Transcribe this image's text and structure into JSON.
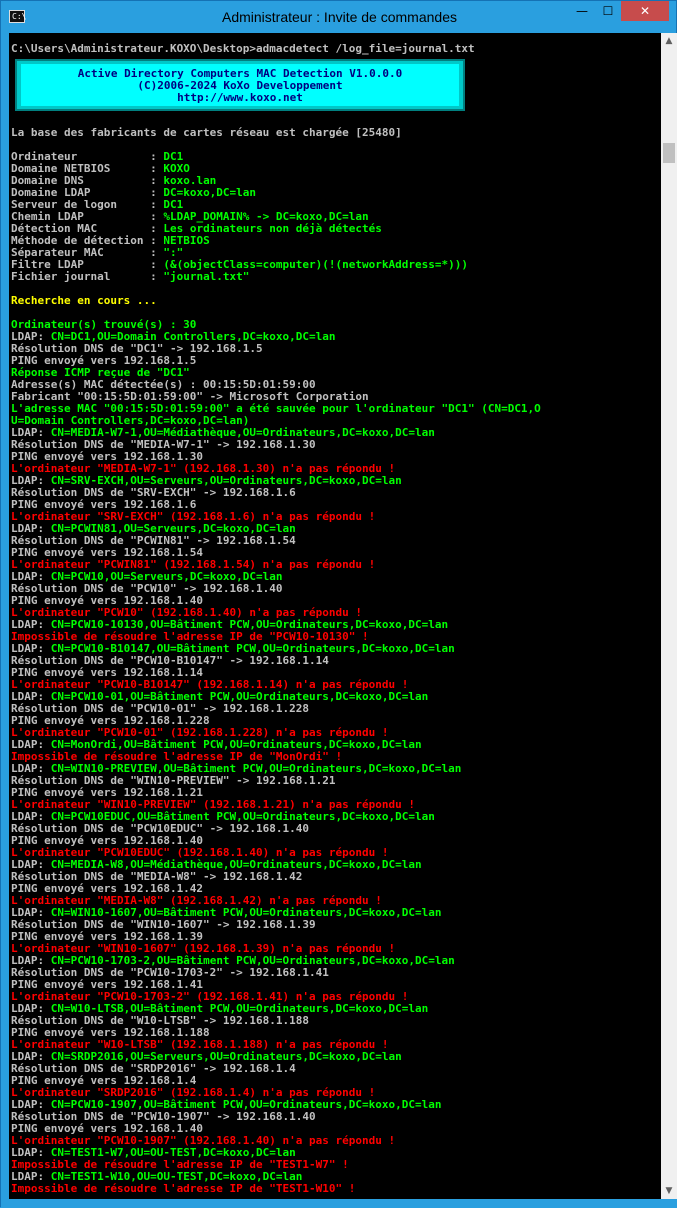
{
  "window": {
    "title": "Administrateur : Invite de commandes",
    "icon_glyph": "C:\\",
    "buttons": {
      "minimize": "—",
      "maximize": "☐",
      "close": "✕"
    }
  },
  "scrollbar": {
    "up": "▲",
    "down": "▼"
  },
  "console": {
    "banner": [
      "Active Directory Computers MAC Detection V1.0.0.0",
      "(C)2006-2024 KoXo Developpement",
      "http://www.koxo.net"
    ],
    "lines": [
      {
        "c": "white",
        "t": "C:\\Users\\Administrateur.KOXO\\Desktop>admacdetect /log_file=journal.txt"
      },
      {
        "c": "white",
        "t": ""
      },
      {
        "c": "white",
        "t": ""
      },
      {
        "c": "white",
        "t": ""
      },
      {
        "c": "white",
        "t": ""
      },
      {
        "c": "white",
        "t": ""
      },
      {
        "c": "white",
        "t": ""
      },
      {
        "c": "white",
        "t": "La base des fabricants de cartes réseau est chargée [25480]"
      },
      {
        "c": "white",
        "t": ""
      },
      {
        "c": "kv",
        "k": "Ordinateur           : ",
        "v": "DC1"
      },
      {
        "c": "kv",
        "k": "Domaine NETBIOS      : ",
        "v": "KOXO"
      },
      {
        "c": "kv",
        "k": "Domaine DNS          : ",
        "v": "koxo.lan"
      },
      {
        "c": "kv",
        "k": "Domaine LDAP         : ",
        "v": "DC=koxo,DC=lan"
      },
      {
        "c": "kv",
        "k": "Serveur de logon     : ",
        "v": "DC1"
      },
      {
        "c": "kv",
        "k": "Chemin LDAP          : ",
        "v": "%LDAP_DOMAIN% -> DC=koxo,DC=lan"
      },
      {
        "c": "kv",
        "k": "Détection MAC        : ",
        "v": "Les ordinateurs non déjà détectés"
      },
      {
        "c": "kv",
        "k": "Méthode de détection : ",
        "v": "NETBIOS"
      },
      {
        "c": "kv",
        "k": "Séparateur MAC       : ",
        "v": "\":\""
      },
      {
        "c": "kv",
        "k": "Filtre LDAP          : ",
        "v": "(&(objectClass=computer)(!(networkAddress=*)))"
      },
      {
        "c": "kv",
        "k": "Fichier journal      : ",
        "v": "\"journal.txt\""
      },
      {
        "c": "white",
        "t": ""
      },
      {
        "c": "yellow",
        "t": "Recherche en cours ..."
      },
      {
        "c": "white",
        "t": ""
      },
      {
        "c": "green",
        "t": "Ordinateur(s) trouvé(s) : 30"
      },
      {
        "c": "ldap",
        "v": "CN=DC1,OU=Domain Controllers,DC=koxo,DC=lan"
      },
      {
        "c": "white",
        "t": "Résolution DNS de \"DC1\" -> 192.168.1.5"
      },
      {
        "c": "white",
        "t": "PING envoyé vers 192.168.1.5"
      },
      {
        "c": "green",
        "t": "Réponse ICMP reçue de \"DC1\""
      },
      {
        "c": "white",
        "t": "Adresse(s) MAC détectée(s) : 00:15:5D:01:59:00"
      },
      {
        "c": "white",
        "t": "Fabricant \"00:15:5D:01:59:00\" -> Microsoft Corporation"
      },
      {
        "c": "green",
        "t": "L'adresse MAC \"00:15:5D:01:59:00\" a été sauvée pour l'ordinateur \"DC1\" (CN=DC1,O"
      },
      {
        "c": "green",
        "t": "U=Domain Controllers,DC=koxo,DC=lan)"
      },
      {
        "c": "ldap",
        "v": "CN=MEDIA-W7-1,OU=Médiathèque,OU=Ordinateurs,DC=koxo,DC=lan"
      },
      {
        "c": "white",
        "t": "Résolution DNS de \"MEDIA-W7-1\" -> 192.168.1.30"
      },
      {
        "c": "white",
        "t": "PING envoyé vers 192.168.1.30"
      },
      {
        "c": "red",
        "t": "L'ordinateur \"MEDIA-W7-1\" (192.168.1.30) n'a pas répondu !"
      },
      {
        "c": "ldap",
        "v": "CN=SRV-EXCH,OU=Serveurs,OU=Ordinateurs,DC=koxo,DC=lan"
      },
      {
        "c": "white",
        "t": "Résolution DNS de \"SRV-EXCH\" -> 192.168.1.6"
      },
      {
        "c": "white",
        "t": "PING envoyé vers 192.168.1.6"
      },
      {
        "c": "red",
        "t": "L'ordinateur \"SRV-EXCH\" (192.168.1.6) n'a pas répondu !"
      },
      {
        "c": "ldap",
        "v": "CN=PCWIN81,OU=Serveurs,DC=koxo,DC=lan"
      },
      {
        "c": "white",
        "t": "Résolution DNS de \"PCWIN81\" -> 192.168.1.54"
      },
      {
        "c": "white",
        "t": "PING envoyé vers 192.168.1.54"
      },
      {
        "c": "red",
        "t": "L'ordinateur \"PCWIN81\" (192.168.1.54) n'a pas répondu !"
      },
      {
        "c": "ldap",
        "v": "CN=PCW10,OU=Serveurs,DC=koxo,DC=lan"
      },
      {
        "c": "white",
        "t": "Résolution DNS de \"PCW10\" -> 192.168.1.40"
      },
      {
        "c": "white",
        "t": "PING envoyé vers 192.168.1.40"
      },
      {
        "c": "red",
        "t": "L'ordinateur \"PCW10\" (192.168.1.40) n'a pas répondu !"
      },
      {
        "c": "ldap",
        "v": "CN=PCW10-10130,OU=Bâtiment PCW,OU=Ordinateurs,DC=koxo,DC=lan"
      },
      {
        "c": "red",
        "t": "Impossible de résoudre l'adresse IP de \"PCW10-10130\" !"
      },
      {
        "c": "ldap",
        "v": "CN=PCW10-B10147,OU=Bâtiment PCW,OU=Ordinateurs,DC=koxo,DC=lan"
      },
      {
        "c": "white",
        "t": "Résolution DNS de \"PCW10-B10147\" -> 192.168.1.14"
      },
      {
        "c": "white",
        "t": "PING envoyé vers 192.168.1.14"
      },
      {
        "c": "red",
        "t": "L'ordinateur \"PCW10-B10147\" (192.168.1.14) n'a pas répondu !"
      },
      {
        "c": "ldap",
        "v": "CN=PCW10-01,OU=Bâtiment PCW,OU=Ordinateurs,DC=koxo,DC=lan"
      },
      {
        "c": "white",
        "t": "Résolution DNS de \"PCW10-01\" -> 192.168.1.228"
      },
      {
        "c": "white",
        "t": "PING envoyé vers 192.168.1.228"
      },
      {
        "c": "red",
        "t": "L'ordinateur \"PCW10-01\" (192.168.1.228) n'a pas répondu !"
      },
      {
        "c": "ldap",
        "v": "CN=MonOrdi,OU=Bâtiment PCW,OU=Ordinateurs,DC=koxo,DC=lan"
      },
      {
        "c": "red",
        "t": "Impossible de résoudre l'adresse IP de \"MonOrdi\" !"
      },
      {
        "c": "ldap",
        "v": "CN=WIN10-PREVIEW,OU=Bâtiment PCW,OU=Ordinateurs,DC=koxo,DC=lan"
      },
      {
        "c": "white",
        "t": "Résolution DNS de \"WIN10-PREVIEW\" -> 192.168.1.21"
      },
      {
        "c": "white",
        "t": "PING envoyé vers 192.168.1.21"
      },
      {
        "c": "red",
        "t": "L'ordinateur \"WIN10-PREVIEW\" (192.168.1.21) n'a pas répondu !"
      },
      {
        "c": "ldap",
        "v": "CN=PCW10EDUC,OU=Bâtiment PCW,OU=Ordinateurs,DC=koxo,DC=lan"
      },
      {
        "c": "white",
        "t": "Résolution DNS de \"PCW10EDUC\" -> 192.168.1.40"
      },
      {
        "c": "white",
        "t": "PING envoyé vers 192.168.1.40"
      },
      {
        "c": "red",
        "t": "L'ordinateur \"PCW10EDUC\" (192.168.1.40) n'a pas répondu !"
      },
      {
        "c": "ldap",
        "v": "CN=MEDIA-W8,OU=Médiathèque,OU=Ordinateurs,DC=koxo,DC=lan"
      },
      {
        "c": "white",
        "t": "Résolution DNS de \"MEDIA-W8\" -> 192.168.1.42"
      },
      {
        "c": "white",
        "t": "PING envoyé vers 192.168.1.42"
      },
      {
        "c": "red",
        "t": "L'ordinateur \"MEDIA-W8\" (192.168.1.42) n'a pas répondu !"
      },
      {
        "c": "ldap",
        "v": "CN=WIN10-1607,OU=Bâtiment PCW,OU=Ordinateurs,DC=koxo,DC=lan"
      },
      {
        "c": "white",
        "t": "Résolution DNS de \"WIN10-1607\" -> 192.168.1.39"
      },
      {
        "c": "white",
        "t": "PING envoyé vers 192.168.1.39"
      },
      {
        "c": "red",
        "t": "L'ordinateur \"WIN10-1607\" (192.168.1.39) n'a pas répondu !"
      },
      {
        "c": "ldap",
        "v": "CN=PCW10-1703-2,OU=Bâtiment PCW,OU=Ordinateurs,DC=koxo,DC=lan"
      },
      {
        "c": "white",
        "t": "Résolution DNS de \"PCW10-1703-2\" -> 192.168.1.41"
      },
      {
        "c": "white",
        "t": "PING envoyé vers 192.168.1.41"
      },
      {
        "c": "red",
        "t": "L'ordinateur \"PCW10-1703-2\" (192.168.1.41) n'a pas répondu !"
      },
      {
        "c": "ldap",
        "v": "CN=W10-LTSB,OU=Bâtiment PCW,OU=Ordinateurs,DC=koxo,DC=lan"
      },
      {
        "c": "white",
        "t": "Résolution DNS de \"W10-LTSB\" -> 192.168.1.188"
      },
      {
        "c": "white",
        "t": "PING envoyé vers 192.168.1.188"
      },
      {
        "c": "red",
        "t": "L'ordinateur \"W10-LTSB\" (192.168.1.188) n'a pas répondu !"
      },
      {
        "c": "ldap",
        "v": "CN=SRDP2016,OU=Serveurs,OU=Ordinateurs,DC=koxo,DC=lan"
      },
      {
        "c": "white",
        "t": "Résolution DNS de \"SRDP2016\" -> 192.168.1.4"
      },
      {
        "c": "white",
        "t": "PING envoyé vers 192.168.1.4"
      },
      {
        "c": "red",
        "t": "L'ordinateur \"SRDP2016\" (192.168.1.4) n'a pas répondu !"
      },
      {
        "c": "ldap",
        "v": "CN=PCW10-1907,OU=Bâtiment PCW,OU=Ordinateurs,DC=koxo,DC=lan"
      },
      {
        "c": "white",
        "t": "Résolution DNS de \"PCW10-1907\" -> 192.168.1.40"
      },
      {
        "c": "white",
        "t": "PING envoyé vers 192.168.1.40"
      },
      {
        "c": "red",
        "t": "L'ordinateur \"PCW10-1907\" (192.168.1.40) n'a pas répondu !"
      },
      {
        "c": "ldap",
        "v": "CN=TEST1-W7,OU=OU-TEST,DC=koxo,DC=lan"
      },
      {
        "c": "red",
        "t": "Impossible de résoudre l'adresse IP de \"TEST1-W7\" !"
      },
      {
        "c": "ldap",
        "v": "CN=TEST1-W10,OU=OU-TEST,DC=koxo,DC=lan"
      },
      {
        "c": "red",
        "t": "Impossible de résoudre l'adresse IP de \"TEST1-W10\" !"
      }
    ],
    "ldap_prefix": "LDAP: "
  },
  "colors": {
    "console_bg": "#000000",
    "text_default": "#c0c0c0",
    "text_green": "#00ff00",
    "text_yellow": "#ffff00",
    "text_red": "#ff0000",
    "banner_bg": "#00ffff",
    "banner_text": "#000080",
    "titlebar": "#2a9fdf",
    "close_button": "#c74c4c"
  }
}
